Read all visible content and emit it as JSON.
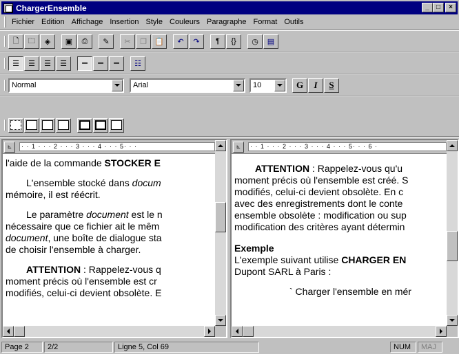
{
  "window": {
    "title": "ChargerEnsemble"
  },
  "menu": [
    "Fichier",
    "Edition",
    "Affichage",
    "Insertion",
    "Style",
    "Couleurs",
    "Paragraphe",
    "Format",
    "Outils"
  ],
  "format_bar": {
    "style": "Normal",
    "font": "Arial",
    "size": "10",
    "bold_label": "G",
    "italic_label": "I",
    "underline_label": "S"
  },
  "ruler": {
    "left": "· · 1 · · · 2 · · · 3 · · · 4 · · · 5· · ·",
    "right": "· · 1 · · · 2 · · · 3 · · · 4 · · · 5· · · 6 ·"
  },
  "left_pane": {
    "l1a": "l'aide de la commande ",
    "l1b": "STOCKER E",
    "p2a": "L'ensemble stocké dans ",
    "p2b": "docum",
    "p2c": "mémoire, il est réécrit.",
    "p3a": "Le paramètre ",
    "p3b": "document",
    "p3c": " est le n",
    "p3d": "nécessaire que ce fichier ait le mêm",
    "p3e": "document",
    "p3f": ", une boîte de dialogue sta",
    "p3g": "de choisir l'ensemble à charger.",
    "p4a": "ATTENTION",
    "p4b": " : Rappelez-vous q",
    "p4c": "moment précis où l'ensemble est cr",
    "p4d": "modifiés, celui-ci devient obsolète. E"
  },
  "right_pane": {
    "a1": "ATTENTION",
    "a2": " : Rappelez-vous qu'u",
    "a3": "moment précis où l'ensemble est créé. S",
    "a4": "modifiés, celui-ci devient obsolète. En c",
    "a5": "avec des enregistrements dont le conte",
    "a6": "ensemble obsolète : modification ou sup",
    "a7": "modification des critères ayant détermin",
    "e1": "Exemple",
    "e2a": "L'exemple suivant utilise ",
    "e2b": "CHARGER EN",
    "e3": "Dupont SARL à Paris :",
    "e4": "` Charger l'ensemble en mér"
  },
  "status": {
    "page": "Page 2",
    "count": "2/2",
    "position": "Ligne 5, Col 69",
    "num": "NUM",
    "maj": "MAJ"
  }
}
